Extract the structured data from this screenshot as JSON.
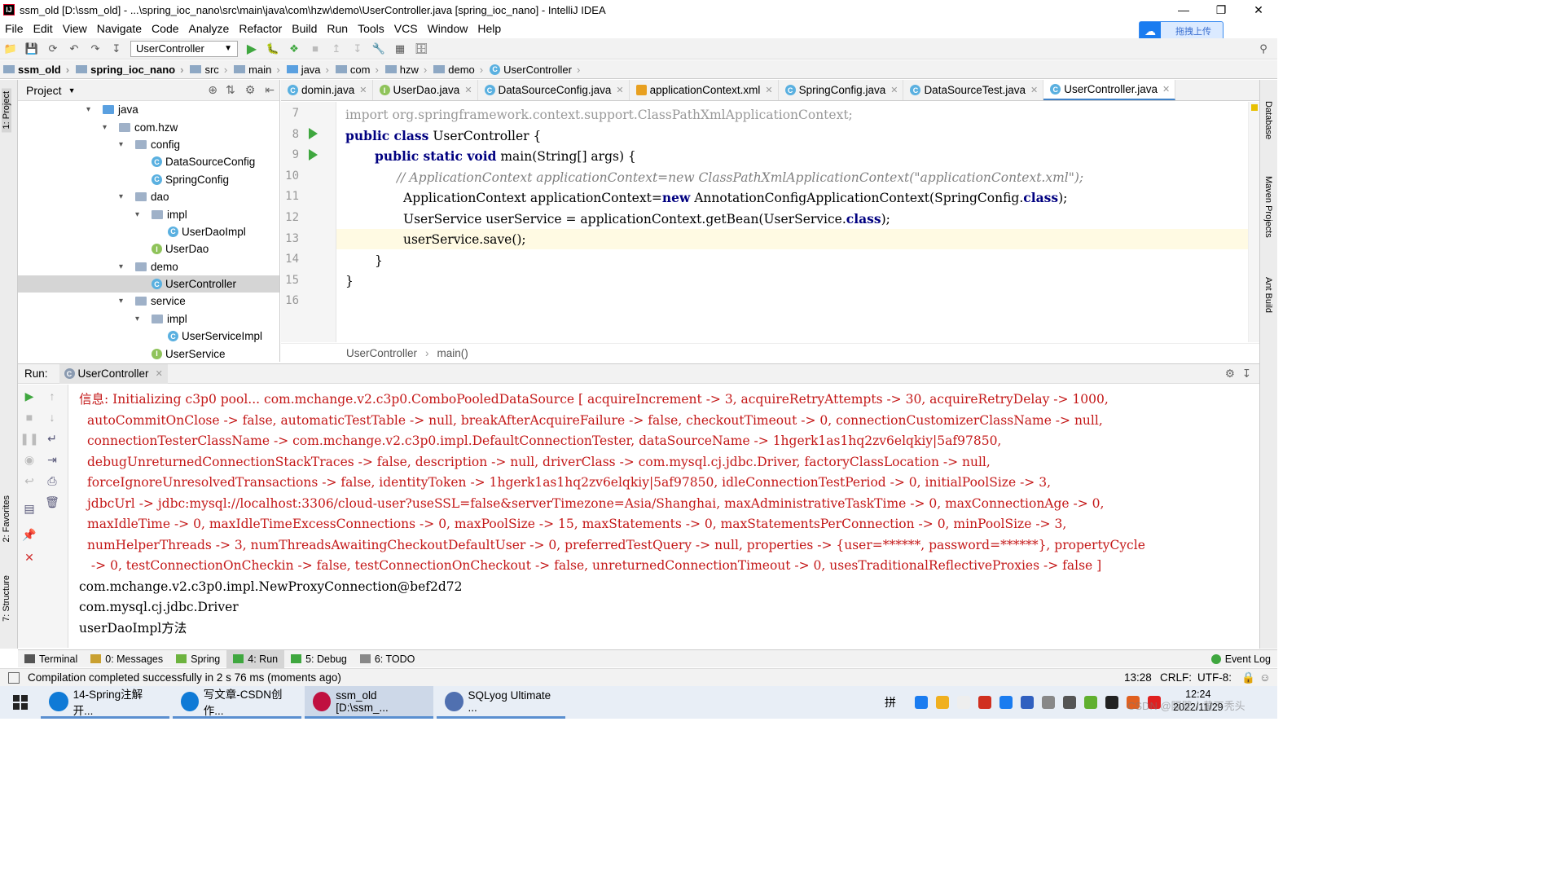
{
  "window": {
    "title": "ssm_old [D:\\ssm_old] - ...\\spring_ioc_nano\\src\\main\\java\\com\\hzw\\demo\\UserController.java [spring_ioc_nano] - IntelliJ IDEA",
    "app_icon": "IJ"
  },
  "menu": [
    "File",
    "Edit",
    "View",
    "Navigate",
    "Code",
    "Analyze",
    "Refactor",
    "Build",
    "Run",
    "Tools",
    "VCS",
    "Window",
    "Help"
  ],
  "upload_button": "拖拽上传",
  "toolbar": {
    "run_config": "UserController"
  },
  "breadcrumb": [
    "ssm_old",
    "spring_ioc_nano",
    "src",
    "main",
    "java",
    "com",
    "hzw",
    "demo",
    "UserController"
  ],
  "left_strip": {
    "project_tab": "1: Project",
    "favorites_tab": "2: Favorites",
    "structure_tab": "7: Structure"
  },
  "right_strip": {
    "database_tab": "Database",
    "maven_tab": "Maven Projects",
    "ant_tab": "Ant Build"
  },
  "project": {
    "header": "Project",
    "tree": [
      {
        "label": "java",
        "type": "folder",
        "depth": 0,
        "expanded": true
      },
      {
        "label": "com.hzw",
        "type": "folder",
        "depth": 1,
        "expanded": true
      },
      {
        "label": "config",
        "type": "folder",
        "depth": 2,
        "expanded": true
      },
      {
        "label": "DataSourceConfig",
        "type": "class",
        "depth": 3
      },
      {
        "label": "SpringConfig",
        "type": "class",
        "depth": 3
      },
      {
        "label": "dao",
        "type": "folder",
        "depth": 2,
        "expanded": true
      },
      {
        "label": "impl",
        "type": "folder",
        "depth": 3,
        "expanded": true
      },
      {
        "label": "UserDaoImpl",
        "type": "class",
        "depth": 4
      },
      {
        "label": "UserDao",
        "type": "interface",
        "depth": 3
      },
      {
        "label": "demo",
        "type": "folder",
        "depth": 2,
        "expanded": true
      },
      {
        "label": "UserController",
        "type": "class",
        "depth": 3,
        "selected": true
      },
      {
        "label": "service",
        "type": "folder",
        "depth": 2,
        "expanded": true
      },
      {
        "label": "impl",
        "type": "folder",
        "depth": 3,
        "expanded": true
      },
      {
        "label": "UserServiceImpl",
        "type": "class",
        "depth": 4
      },
      {
        "label": "UserService",
        "type": "interface",
        "depth": 3
      }
    ]
  },
  "editor_tabs": [
    {
      "label": "domin.java",
      "icon": "C"
    },
    {
      "label": "UserDao.java",
      "icon": "I"
    },
    {
      "label": "DataSourceConfig.java",
      "icon": "C"
    },
    {
      "label": "applicationContext.xml",
      "icon": "X"
    },
    {
      "label": "SpringConfig.java",
      "icon": "C"
    },
    {
      "label": "DataSourceTest.java",
      "icon": "C"
    },
    {
      "label": "UserController.java",
      "icon": "C",
      "active": true
    }
  ],
  "editor": {
    "line_numbers": [
      "7",
      "8",
      "9",
      "10",
      "11",
      "12",
      "13",
      "14",
      "15",
      "16"
    ],
    "lines": {
      "l7_kw": "import",
      "l7_rest": " org.springframework.context.support.ClassPathXmlApplicationContext;",
      "l8_kw": "public class",
      "l8_rest": " UserController {",
      "l9_kw": "public static void",
      "l9_rest": " main(String[] args) {",
      "l10": "// ApplicationContext applicationContext=new ClassPathXmlApplicationContext(\"applicationContext.xml\");",
      "l11_a": "ApplicationContext applicationContext=",
      "l11_kw": "new",
      "l11_b": " AnnotationConfigApplicationContext(SpringConfig.",
      "l11_kw2": "class",
      "l11_c": ");",
      "l12_a": "UserService userService = applicationContext.getBean(UserService.",
      "l12_kw": "class",
      "l12_c": ");",
      "l13": "userService.save();",
      "l14": "}",
      "l15": "}"
    },
    "crumb": [
      "UserController",
      "main()"
    ]
  },
  "run_panel": {
    "label": "Run:",
    "tab": "UserController",
    "console": [
      {
        "text": "信息: Initializing c3p0 pool... com.mchange.v2.c3p0.ComboPooledDataSource [ acquireIncrement -> 3, acquireRetryAttempts -> 30, acquireRetryDelay -> 1000,",
        "color": "red",
        "indent": 0
      },
      {
        "text": "autoCommitOnClose -> false, automaticTestTable -> null, breakAfterAcquireFailure -> false, checkoutTimeout -> 0, connectionCustomizerClassName -> null,",
        "color": "red",
        "indent": 1
      },
      {
        "text": "connectionTesterClassName -> com.mchange.v2.c3p0.impl.DefaultConnectionTester, dataSourceName -> 1hgerk1as1hq2zv6elqkiy|5af97850,",
        "color": "red",
        "indent": 1
      },
      {
        "text": "debugUnreturnedConnectionStackTraces -> false, description -> null, driverClass -> com.mysql.cj.jdbc.Driver, factoryClassLocation -> null,",
        "color": "red",
        "indent": 1
      },
      {
        "text": "forceIgnoreUnresolvedTransactions -> false, identityToken -> 1hgerk1as1hq2zv6elqkiy|5af97850, idleConnectionTestPeriod -> 0, initialPoolSize -> 3,",
        "color": "red",
        "indent": 1
      },
      {
        "text": "jdbcUrl -> jdbc:mysql://localhost:3306/cloud-user?useSSL=false&serverTimezone=Asia/Shanghai, maxAdministrativeTaskTime -> 0, maxConnectionAge -> 0,",
        "color": "red",
        "indent": 1
      },
      {
        "text": "maxIdleTime -> 0, maxIdleTimeExcessConnections -> 0, maxPoolSize -> 15, maxStatements -> 0, maxStatementsPerConnection -> 0, minPoolSize -> 3,",
        "color": "red",
        "indent": 1
      },
      {
        "text": "numHelperThreads -> 3, numThreadsAwaitingCheckoutDefaultUser -> 0, preferredTestQuery -> null, properties -> {user=******, password=******}, propertyCycle",
        "color": "red",
        "indent": 1
      },
      {
        "text": " -> 0, testConnectionOnCheckin -> false, testConnectionOnCheckout -> false, unreturnedConnectionTimeout -> 0, usesTraditionalReflectiveProxies -> false ]",
        "color": "red",
        "indent": 1
      },
      {
        "text": "com.mchange.v2.c3p0.impl.NewProxyConnection@bef2d72",
        "color": "black",
        "indent": 0
      },
      {
        "text": "com.mysql.cj.jdbc.Driver",
        "color": "black",
        "indent": 0
      },
      {
        "text": "userDaoImpl方法",
        "color": "black",
        "indent": 0
      }
    ]
  },
  "bottom_tabs": [
    {
      "label": "Terminal",
      "icon": "terminal-icon"
    },
    {
      "label": "0: Messages",
      "icon": "messages-icon"
    },
    {
      "label": "Spring",
      "icon": "spring-icon"
    },
    {
      "label": "4: Run",
      "icon": "run-icon",
      "active": true
    },
    {
      "label": "5: Debug",
      "icon": "debug-icon"
    },
    {
      "label": "6: TODO",
      "icon": "todo-icon"
    }
  ],
  "event_log": "Event Log",
  "status": {
    "message": "Compilation completed successfully in 2 s 76 ms (moments ago)",
    "position": "13:28",
    "line_sep": "CRLF:",
    "encoding": "UTF-8:"
  },
  "taskbar": {
    "items": [
      {
        "label": "14-Spring注解开...",
        "color": "#0f7ad6"
      },
      {
        "label": "写文章-CSDN创作...",
        "color": "#0f7ad6"
      },
      {
        "label": "ssm_old [D:\\ssm_...",
        "color": "#c01040",
        "active": true
      },
      {
        "label": "SQLyog Ultimate ...",
        "color": "#5070b0"
      }
    ],
    "ime": "拼",
    "time": "12:24",
    "date": "2022/11/29",
    "watermark": "CSDN @隔壁小黄不秃头"
  }
}
